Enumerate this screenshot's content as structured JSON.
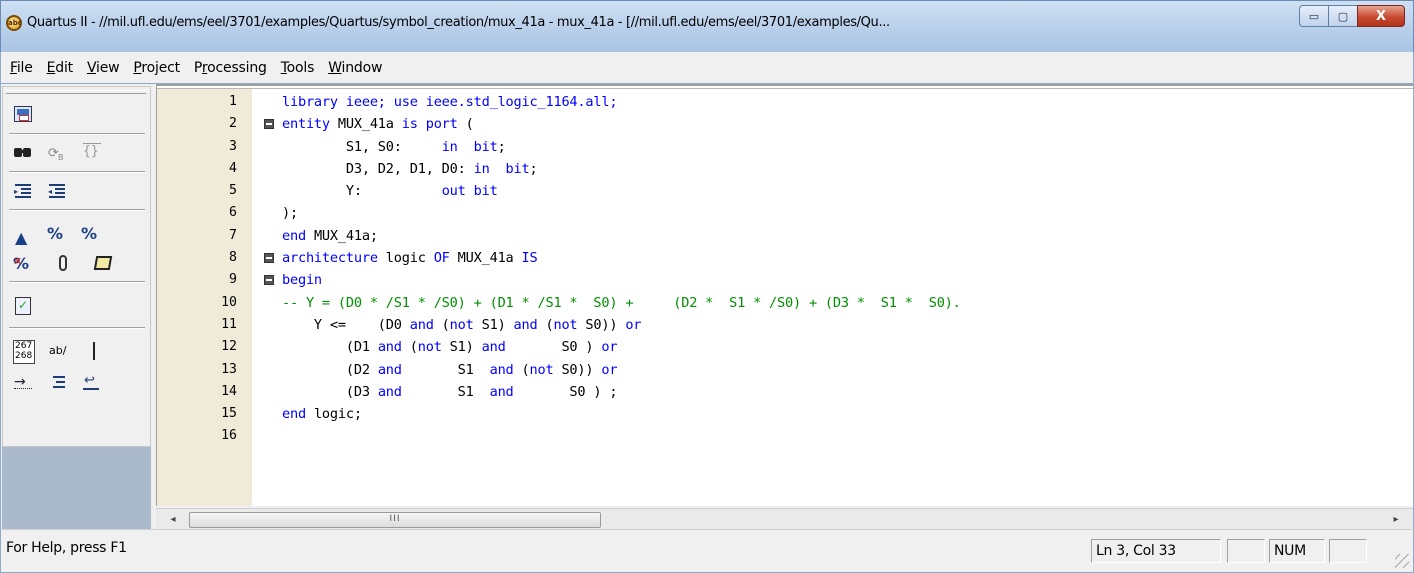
{
  "window": {
    "title": "Quartus II - //mil.ufl.edu/ems/eel/3701/examples/Quartus/symbol_creation/mux_41a - mux_41a - [//mil.ufl.edu/ems/eel/3701/examples/Qu...",
    "minimize_glyph": "▭",
    "maximize_glyph": "▢",
    "close_glyph": "X"
  },
  "menu": [
    {
      "pre": "",
      "u": "F",
      "post": "ile"
    },
    {
      "pre": "",
      "u": "E",
      "post": "dit"
    },
    {
      "pre": "",
      "u": "V",
      "post": "iew"
    },
    {
      "pre": "",
      "u": "P",
      "post": "roject"
    },
    {
      "pre": "P",
      "u": "r",
      "post": "ocessing"
    },
    {
      "pre": "",
      "u": "T",
      "post": "ools"
    },
    {
      "pre": "",
      "u": "W",
      "post": "indow"
    }
  ],
  "toolbar": {
    "icons": [
      "insert-symbol-icon",
      "find-icon",
      "find-matching-icon",
      "bracket-icon",
      "indent-increase-icon",
      "indent-decrease-icon",
      "bookmark-icon",
      "bookmark-next-icon",
      "bookmark-prev-icon",
      "bookmark-clear-icon",
      "paperclip-icon",
      "scroll-icon",
      "check-syntax-icon",
      "line-numbers-icon",
      "text-icon",
      "cursor-line-icon",
      "tab-arrow-icon",
      "list-icon",
      "wrap-icon"
    ],
    "line_numbers_top": "267",
    "line_numbers_bottom": "268",
    "text_label": "ab/"
  },
  "editor": {
    "lines": [
      {
        "n": "1",
        "fold": false,
        "tokens": [
          [
            "kw",
            "library ieee; use ieee.std_logic_1164.all;"
          ]
        ]
      },
      {
        "n": "2",
        "fold": true,
        "tokens": [
          [
            "kw",
            "entity "
          ],
          [
            "t",
            "MUX_41a "
          ],
          [
            "kw",
            "is port"
          ],
          [
            "t",
            " ("
          ]
        ]
      },
      {
        "n": "3",
        "fold": false,
        "tokens": [
          [
            "t",
            "        S1, S0:     "
          ],
          [
            "kw",
            "in  bit"
          ],
          [
            "t",
            ";"
          ]
        ]
      },
      {
        "n": "4",
        "fold": false,
        "tokens": [
          [
            "t",
            "        D3, D2, D1, D0: "
          ],
          [
            "kw",
            "in  bit"
          ],
          [
            "t",
            ";"
          ]
        ]
      },
      {
        "n": "5",
        "fold": false,
        "tokens": [
          [
            "t",
            "        Y:          "
          ],
          [
            "kw",
            "out bit"
          ]
        ]
      },
      {
        "n": "6",
        "fold": false,
        "tokens": [
          [
            "t",
            ");"
          ]
        ]
      },
      {
        "n": "7",
        "fold": false,
        "tokens": [
          [
            "kw",
            "end "
          ],
          [
            "t",
            "MUX_41a;"
          ]
        ]
      },
      {
        "n": "8",
        "fold": true,
        "tokens": [
          [
            "kw",
            "architecture "
          ],
          [
            "t",
            "logic "
          ],
          [
            "kw",
            "OF "
          ],
          [
            "t",
            "MUX_41a "
          ],
          [
            "kw",
            "IS"
          ]
        ]
      },
      {
        "n": "9",
        "fold": true,
        "tokens": [
          [
            "kw",
            "begin"
          ]
        ]
      },
      {
        "n": "10",
        "fold": false,
        "tokens": [
          [
            "cm",
            "-- Y = (D0 * /S1 * /S0) + (D1 * /S1 *  S0) +     (D2 *  S1 * /S0) + (D3 *  S1 *  S0)."
          ]
        ]
      },
      {
        "n": "11",
        "fold": false,
        "tokens": [
          [
            "t",
            "    Y <=    (D0 "
          ],
          [
            "kw",
            "and"
          ],
          [
            "t",
            " ("
          ],
          [
            "kw",
            "not"
          ],
          [
            "t",
            " S1) "
          ],
          [
            "kw",
            "and"
          ],
          [
            "t",
            " ("
          ],
          [
            "kw",
            "not"
          ],
          [
            "t",
            " S0)) "
          ],
          [
            "kw",
            "or"
          ]
        ]
      },
      {
        "n": "12",
        "fold": false,
        "tokens": [
          [
            "t",
            "        (D1 "
          ],
          [
            "kw",
            "and"
          ],
          [
            "t",
            " ("
          ],
          [
            "kw",
            "not"
          ],
          [
            "t",
            " S1) "
          ],
          [
            "kw",
            "and"
          ],
          [
            "t",
            "       S0 ) "
          ],
          [
            "kw",
            "or"
          ]
        ]
      },
      {
        "n": "13",
        "fold": false,
        "tokens": [
          [
            "t",
            "        (D2 "
          ],
          [
            "kw",
            "and"
          ],
          [
            "t",
            "       S1  "
          ],
          [
            "kw",
            "and"
          ],
          [
            "t",
            " ("
          ],
          [
            "kw",
            "not"
          ],
          [
            "t",
            " S0)) "
          ],
          [
            "kw",
            "or"
          ]
        ]
      },
      {
        "n": "14",
        "fold": false,
        "tokens": [
          [
            "t",
            "        (D3 "
          ],
          [
            "kw",
            "and"
          ],
          [
            "t",
            "       S1  "
          ],
          [
            "kw",
            "and"
          ],
          [
            "t",
            "       S0 ) ;"
          ]
        ]
      },
      {
        "n": "15",
        "fold": false,
        "tokens": [
          [
            "kw",
            "end "
          ],
          [
            "t",
            "logic;"
          ]
        ]
      },
      {
        "n": "16",
        "fold": false,
        "tokens": []
      }
    ]
  },
  "scrollbar": {
    "left_arrow": "◂",
    "right_arrow": "▸",
    "thumb_grip": "III"
  },
  "status": {
    "help": "For Help, press F1",
    "cursor": "Ln 3, Col 33",
    "num": "NUM"
  },
  "colors": {
    "keyword": "#0000ff",
    "comment": "#009000",
    "gutter": "#f0ebd8"
  }
}
